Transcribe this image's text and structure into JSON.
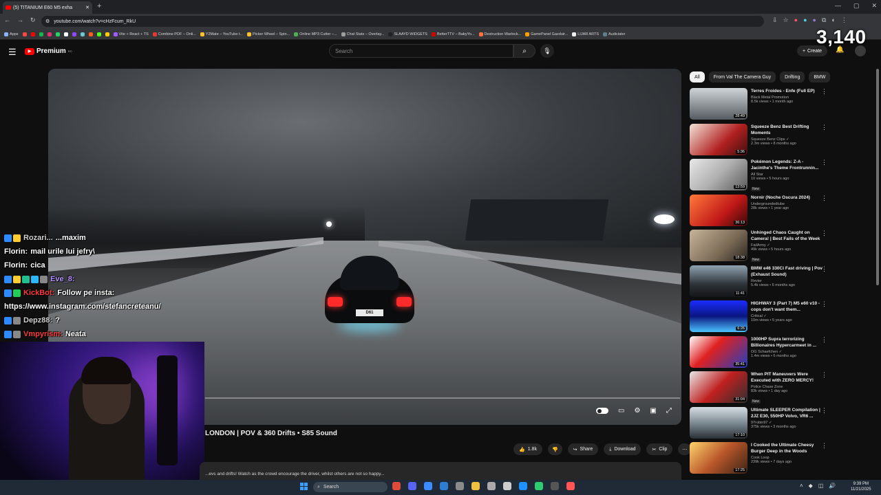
{
  "browser": {
    "tab_title": "(5) TITANIUM E60 M5 exha",
    "new_tab": "+",
    "url": "youtube.com/watch?v=cHzFcum_RkU",
    "window_controls": [
      "—",
      "▢",
      "✕"
    ],
    "bookmarks": [
      {
        "label": "Apps",
        "color": "#8ab4f8"
      },
      {
        "label": "",
        "color": "#ff4444"
      },
      {
        "label": "",
        "color": "#ff0000"
      },
      {
        "label": "",
        "color": "#1ab34f"
      },
      {
        "label": "",
        "color": "#e1306c"
      },
      {
        "label": "",
        "color": "#25d366"
      },
      {
        "label": "",
        "color": "#ffffff"
      },
      {
        "label": "",
        "color": "#9146ff"
      },
      {
        "label": "",
        "color": "#69c9d0"
      },
      {
        "label": "",
        "color": "#ff5a1f"
      },
      {
        "label": "",
        "color": "#53fc18"
      },
      {
        "label": "",
        "color": "#ffcc00"
      },
      {
        "label": "Vite + React + TS",
        "color": "#a259ff"
      },
      {
        "label": "Combine PDF – Onli...",
        "color": "#e53935"
      },
      {
        "label": "Y2Mate – YouTube t...",
        "color": "#fbc02d"
      },
      {
        "label": "Picker Wheel – Spin...",
        "color": "#fbc02d"
      },
      {
        "label": "Online MP3 Cutter –...",
        "color": "#4caf50"
      },
      {
        "label": "Chat Stats – Overlay...",
        "color": "#9e9e9e"
      },
      {
        "label": "SLAAYD WIDGETS",
        "color": "#222222"
      },
      {
        "label": "BetterTTV – BabyYo...",
        "color": "#d50000"
      },
      {
        "label": "Destruction Warlock...",
        "color": "#ff7043"
      },
      {
        "label": "GamePanel Gazduir...",
        "color": "#ffa000"
      },
      {
        "label": "LIJAR ARTS",
        "color": "#eeeeee"
      },
      {
        "label": "Audiciater",
        "color": "#607d8b"
      }
    ]
  },
  "stream_overlay": {
    "counter": "3,140",
    "chat": [
      {
        "user": "Rozari...",
        "message": "...maxim",
        "user_class": "u-gray",
        "badges": [
          "#2d8bff",
          "#ffcc33"
        ]
      },
      {
        "user": "Florin:",
        "message": "mail urile lui jefry\\",
        "user_class": "u-white",
        "badges": []
      },
      {
        "user": "Florin:",
        "message": "cica",
        "user_class": "u-white",
        "badges": []
      },
      {
        "user": "Eve_8:",
        "message": "",
        "user_class": "u-purple",
        "badges": [
          "#2d8bff",
          "#ffcc33",
          "#1fbf8f",
          "#2db6ff",
          "#888888"
        ]
      },
      {
        "user": "KickBot:",
        "message": "Follow pe insta:",
        "user_class": "u-red",
        "badges": [
          "#2d8bff",
          "#22cc55"
        ]
      },
      {
        "user": "",
        "message": "https://www.instagram.com/stefancreteanu/",
        "user_class": "u-white",
        "badges": []
      },
      {
        "user": "Depz88:",
        "message": "?",
        "user_class": "u-gray",
        "badges": [
          "#2d8bff",
          "#888888"
        ]
      },
      {
        "user": "Vmpyrism:",
        "message": "Neata",
        "user_class": "u-red",
        "badges": [
          "#2d8bff",
          "#888888"
        ]
      }
    ]
  },
  "youtube": {
    "logo_text": "Premium",
    "logo_sup": "RO",
    "search_placeholder": "Search",
    "create_label": "Create",
    "video_title": "LONDON | POV & 360 Drifts • S85 Sound",
    "plate_text": "D61",
    "actions": {
      "likes": "1.8k",
      "share": "Share",
      "download": "Download",
      "clip": "Clip"
    },
    "description": "...evs and drifts! Watch as the crowd encourage the driver, whilst others are not so happy...",
    "chips": [
      {
        "label": "All",
        "active": true
      },
      {
        "label": "From Val The Camera Guy",
        "active": false
      },
      {
        "label": "Drifting",
        "active": false
      },
      {
        "label": "BMW",
        "active": false
      }
    ],
    "recommendations": [
      {
        "title": "Terres Froides - Enfe (Full EP)",
        "channel": "Black Metal Promotion",
        "meta": "8.5k views • 1 month ago",
        "duration": "28:49",
        "new": "",
        "thumb": "linear-gradient(180deg,#cfd4d8,#555b60)"
      },
      {
        "title": "Squeeze Benz Best Drifting Moments",
        "channel": "Squeeze Benz Clips ✓",
        "meta": "2.3m views • 8 months ago",
        "duration": "5:36",
        "new": "",
        "thumb": "linear-gradient(135deg,#f2e3d8,#b12020 60%,#401010)"
      },
      {
        "title": "Pokémon Legends: Z-A - Jacinthe's Theme Frontrunnin...",
        "channel": "All Star",
        "meta": "10 views • 5 hours ago",
        "duration": "13:59",
        "new": "New",
        "thumb": "linear-gradient(135deg,#e8e8e8,#b0b0b0 50%,#5a5a5a)"
      },
      {
        "title": "Nornir (Noche Oscura 2024)",
        "channel": "Undergroundedtube",
        "meta": "28k views • 1 year ago",
        "duration": "36:13",
        "new": "",
        "thumb": "linear-gradient(135deg,#ff7a3a,#c01818 60%,#3a0808)"
      },
      {
        "title": "Unhinged Chaos Caught on Camera! | Best Fails of the Week",
        "channel": "FailArmy ✓",
        "meta": "49k views • 5 hours ago",
        "duration": "18:38",
        "new": "New",
        "thumb": "linear-gradient(135deg,#c7b49a,#7a6a55 60%,#2a2420)"
      },
      {
        "title": "BMW e46 330Ci Fast driving | Pov (Exhaust Sound)",
        "channel": "Revier",
        "meta": "5.4k views • 6 months ago",
        "duration": "11:41",
        "new": "",
        "thumb": "linear-gradient(180deg,#8fa3b0,#2d3338 60%,#141618)"
      },
      {
        "title": "HIGHWAY 3 (Part 7) M5 e60 v10 - cops don't want them...",
        "channel": "Critical ✓",
        "meta": "10m views • 5 years ago",
        "duration": "6:26",
        "new": "",
        "thumb": "linear-gradient(180deg,#1a2cff,#0a1680 50%,#4cc3ff)"
      },
      {
        "title": "1000HP Supra terrorizing Billionaires Hypercarmeet in ...",
        "channel": "OG Schaefchen ✓",
        "meta": "1.4m views • 6 months ago",
        "duration": "35:41",
        "new": "",
        "thumb": "linear-gradient(135deg,#ffffff,#e02020 40%,#2040c0)"
      },
      {
        "title": "When PIT Maneuvers Were Executed with ZERO MERCY!",
        "channel": "Police Chase Zone",
        "meta": "83k views • 1 day ago",
        "duration": "31:04",
        "new": "New",
        "thumb": "linear-gradient(135deg,#e8e8e8,#c02020 50%,#303030)"
      },
      {
        "title": "Ultimate SLEEPER Compilation | 2JZ E30, 550HP Volvo, VR6 ...",
        "channel": "97robin97 ✓",
        "meta": "375k views • 3 months ago",
        "duration": "17:10",
        "new": "",
        "thumb": "linear-gradient(180deg,#d6dee4,#6d7a82 60%,#2a3034)"
      },
      {
        "title": "I Cooked the Ultimate Cheesy Burger Deep in the Woods",
        "channel": "Cook Loop",
        "meta": "239k views • 7 days ago",
        "duration": "17:25",
        "new": "",
        "thumb": "linear-gradient(135deg,#ffd36b,#b8562a 50%,#3a2414)"
      }
    ]
  },
  "taskbar": {
    "search_label": "Search",
    "time": "9:39 PM",
    "date": "11/21/2025",
    "apps": [
      "#e04a3a",
      "#5865f2",
      "#3c8cff",
      "#2d7dd2",
      "#8a8a8a",
      "#f0c040",
      "#aaaaaa",
      "#cccccc",
      "#1e90ff",
      "#2ecc71",
      "#555555",
      "#ff5555"
    ]
  }
}
